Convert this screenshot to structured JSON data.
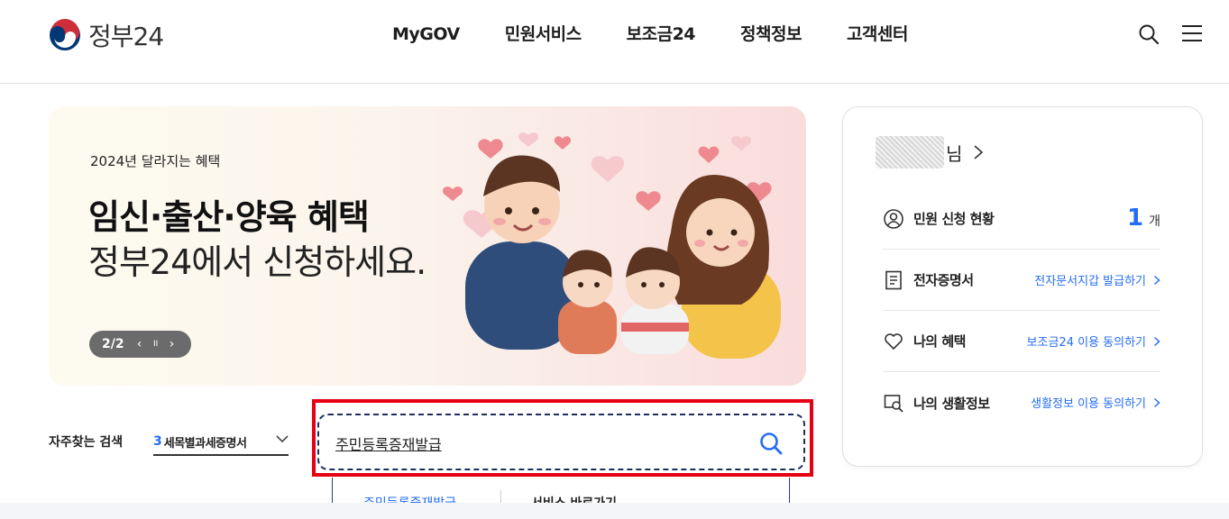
{
  "header": {
    "logo_text": "정부24",
    "nav": [
      "MyGOV",
      "민원서비스",
      "보조금24",
      "정책정보",
      "고객센터"
    ],
    "icons": [
      "search-icon",
      "hamburger-menu-icon"
    ]
  },
  "banner": {
    "subtitle": "2024년 달라지는 혜택",
    "title": "임신·출산·양육 혜택",
    "description": "정부24에서 신청하세요.",
    "pager": "2/2",
    "prev": "‹",
    "pause": "II",
    "next": "›"
  },
  "quick_search": {
    "label": "자주찾는 검색",
    "selected_number": "3",
    "selected_text": "세목별과세증명서"
  },
  "search": {
    "value": "주민등록증재발급",
    "placeholder": ""
  },
  "dropdown": {
    "item": "주민등록증재발급",
    "shortcut": "서비스 바로가기"
  },
  "panel": {
    "user_suffix": "님",
    "rows": [
      {
        "label": "민원 신청 현황",
        "count": "1",
        "unit": "개"
      },
      {
        "label": "전자증명서",
        "action": "전자문서지갑 발급하기"
      },
      {
        "label": "나의 혜택",
        "action": "보조금24 이용 동의하기"
      },
      {
        "label": "나의 생활정보",
        "action": "생활정보 이용 동의하기"
      }
    ]
  },
  "colors": {
    "accent": "#256ef4",
    "highlight": "#e60012",
    "navy": "#1b2f5e"
  }
}
